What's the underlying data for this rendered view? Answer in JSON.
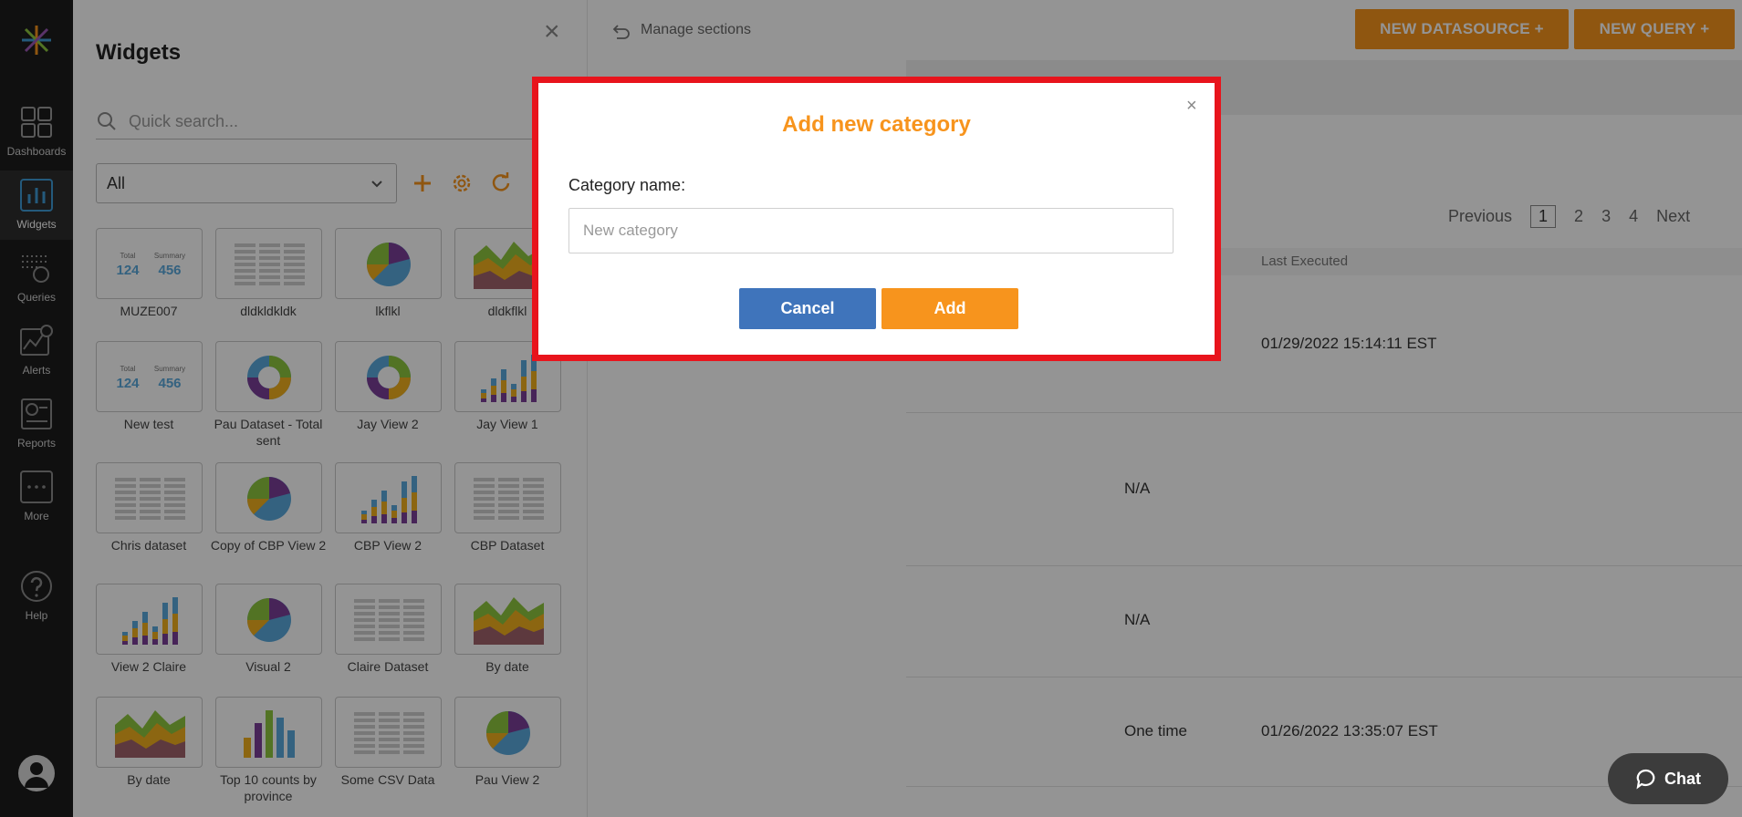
{
  "nav": {
    "items": [
      {
        "label": "Dashboards",
        "icon": "dashboards-icon"
      },
      {
        "label": "Widgets",
        "icon": "widgets-icon",
        "active": true
      },
      {
        "label": "Queries",
        "icon": "queries-icon"
      },
      {
        "label": "Alerts",
        "icon": "alerts-icon"
      },
      {
        "label": "Reports",
        "icon": "reports-icon"
      },
      {
        "label": "More",
        "icon": "more-icon"
      },
      {
        "label": "Help",
        "icon": "help-icon"
      }
    ]
  },
  "header": {
    "new_datasource": "NEW DATASOURCE +",
    "new_query": "NEW QUERY +"
  },
  "pagination": {
    "previous": "Previous",
    "pages": [
      "1",
      "2",
      "3",
      "4"
    ],
    "current": "1",
    "next": "Next"
  },
  "table": {
    "column_last_executed": "Last Executed",
    "rows": [
      {
        "schedule": "",
        "last_executed": "01/29/2022 15:14:11 EST"
      },
      {
        "schedule": "N/A",
        "last_executed": ""
      },
      {
        "schedule": "N/A",
        "last_executed": ""
      },
      {
        "schedule": "One time",
        "last_executed": "01/26/2022 13:35:07 EST"
      }
    ]
  },
  "widgets_panel": {
    "title": "Widgets",
    "search_placeholder": "Quick search...",
    "filter_value": "All",
    "manage_sections": "Manage sections",
    "tiles": [
      {
        "name": "MUZE007",
        "thumb": "summary"
      },
      {
        "name": "dldkldkldk",
        "thumb": "table"
      },
      {
        "name": "lkflkl",
        "thumb": "pie"
      },
      {
        "name": "dldkflkl",
        "thumb": "area"
      },
      {
        "name": "New test",
        "thumb": "summary"
      },
      {
        "name": "Pau Dataset - Total sent",
        "thumb": "donut"
      },
      {
        "name": "Jay View 2",
        "thumb": "donut"
      },
      {
        "name": "Jay View 1",
        "thumb": "bars"
      },
      {
        "name": "Chris dataset",
        "thumb": "table"
      },
      {
        "name": "Copy of CBP View 2",
        "thumb": "pie"
      },
      {
        "name": "CBP View 2",
        "thumb": "bars"
      },
      {
        "name": "CBP Dataset",
        "thumb": "table"
      },
      {
        "name": "View 2 Claire",
        "thumb": "bars"
      },
      {
        "name": "Visual 2",
        "thumb": "pie"
      },
      {
        "name": "Claire Dataset",
        "thumb": "table"
      },
      {
        "name": "By date",
        "thumb": "area"
      },
      {
        "name": "By date",
        "thumb": "area"
      },
      {
        "name": "Top 10 counts by province",
        "thumb": "vbars"
      },
      {
        "name": "Some CSV Data",
        "thumb": "table"
      },
      {
        "name": "Pau View 2",
        "thumb": "pie"
      }
    ],
    "summary_thumb": {
      "k1": "Total",
      "v1": "124",
      "k2": "Summary",
      "v2": "456"
    }
  },
  "modal": {
    "title": "Add new category",
    "close": "×",
    "label": "Category name:",
    "placeholder": "New category",
    "value": "",
    "cancel": "Cancel",
    "add": "Add"
  },
  "chat": {
    "label": "Chat"
  },
  "colors": {
    "accent": "#f7941d",
    "primary": "#3f74bb",
    "highlight_border": "#e8141c",
    "nav_bg": "#1d1d1d"
  }
}
